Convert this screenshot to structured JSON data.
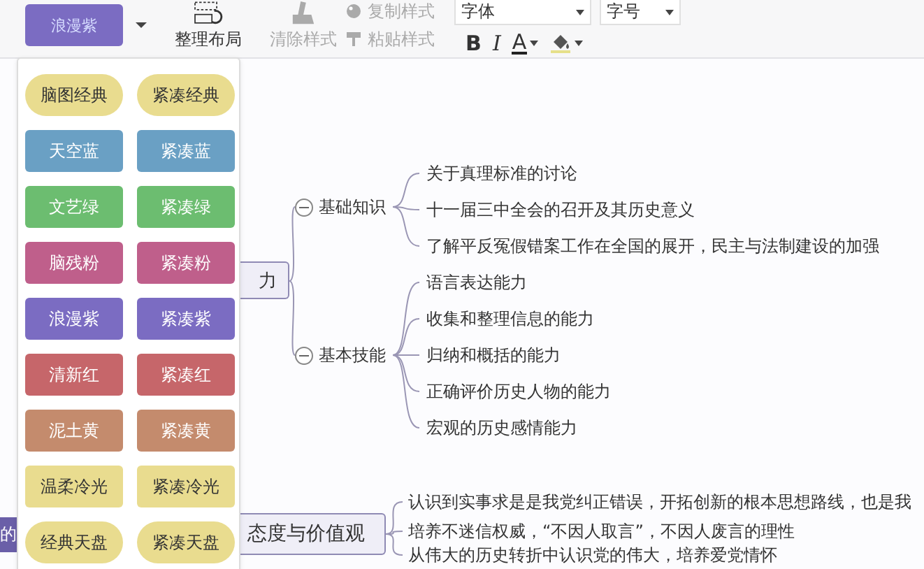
{
  "toolbar": {
    "theme_button": "浪漫紫",
    "layout_button": "整理布局",
    "clear_style": {
      "label": "清除样式",
      "disabled": true
    },
    "copy_style": {
      "label": "复制样式",
      "disabled": true
    },
    "paste_style": {
      "label": "粘贴样式",
      "disabled": true
    },
    "font_select": "字体",
    "size_select": "字号",
    "bold": "B",
    "italic": "I",
    "font_color": "A"
  },
  "theme_menu": [
    {
      "label": "脑图经典",
      "kind": "pill",
      "color": "#e9dc8f"
    },
    {
      "label": "紧凑经典",
      "kind": "pill",
      "color": "#e9dc8f"
    },
    {
      "label": "天空蓝",
      "kind": "rect",
      "color": "#6aa0c4"
    },
    {
      "label": "紧凑蓝",
      "kind": "rect",
      "color": "#6aa0c4"
    },
    {
      "label": "文艺绿",
      "kind": "rect",
      "color": "#6cbd70"
    },
    {
      "label": "紧凑绿",
      "kind": "rect",
      "color": "#6cbd70"
    },
    {
      "label": "脑残粉",
      "kind": "rect",
      "color": "#bf5f8b"
    },
    {
      "label": "紧凑粉",
      "kind": "rect",
      "color": "#bf5f8b"
    },
    {
      "label": "浪漫紫",
      "kind": "rect",
      "color": "#7b6cc2"
    },
    {
      "label": "紧凑紫",
      "kind": "rect",
      "color": "#7b6cc2"
    },
    {
      "label": "清新红",
      "kind": "rect",
      "color": "#c6666a"
    },
    {
      "label": "紧凑红",
      "kind": "rect",
      "color": "#c6666a"
    },
    {
      "label": "泥土黄",
      "kind": "rect",
      "color": "#c48b6d"
    },
    {
      "label": "紧凑黄",
      "kind": "rect",
      "color": "#c48b6d"
    },
    {
      "label": "温柔冷光",
      "kind": "rect",
      "color": "#e9dc8f"
    },
    {
      "label": "紧凑冷光",
      "kind": "rect",
      "color": "#e9dc8f"
    },
    {
      "label": "经典天盘",
      "kind": "pill",
      "color": "#e9dc8f"
    },
    {
      "label": "紧凑天盘",
      "kind": "pill",
      "color": "#e9dc8f"
    }
  ],
  "mind_map": {
    "nodes": [
      {
        "text": "力",
        "kind": "main",
        "children": [
          {
            "text": "基础知识",
            "expanded": true,
            "children": [
              {
                "text": "关于真理标准的讨论"
              },
              {
                "text": "十一届三中全会的召开及其历史意义"
              },
              {
                "text": "了解平反冤假错案工作在全国的展开，民主与法制建设的加强"
              }
            ]
          },
          {
            "text": "基本技能",
            "expanded": true,
            "children": [
              {
                "text": "语言表达能力"
              },
              {
                "text": "收集和整理信息的能力"
              },
              {
                "text": "归纳和概括的能力"
              },
              {
                "text": "正确评价历史人物的能力"
              },
              {
                "text": "宏观的历史感情能力"
              }
            ]
          }
        ]
      },
      {
        "text": "的",
        "kind": "filled"
      },
      {
        "text": "态度与价值观",
        "kind": "main",
        "children": [
          {
            "text": "认识到实事求是是我党纠正错误，开拓创新的根本思想路线，也是我"
          },
          {
            "text": "培养不迷信权威，“不因人取言”，不因人废言的理性"
          },
          {
            "text": "从伟大的历史转折中认识党的伟大，培养爱党情怀"
          }
        ]
      }
    ]
  }
}
